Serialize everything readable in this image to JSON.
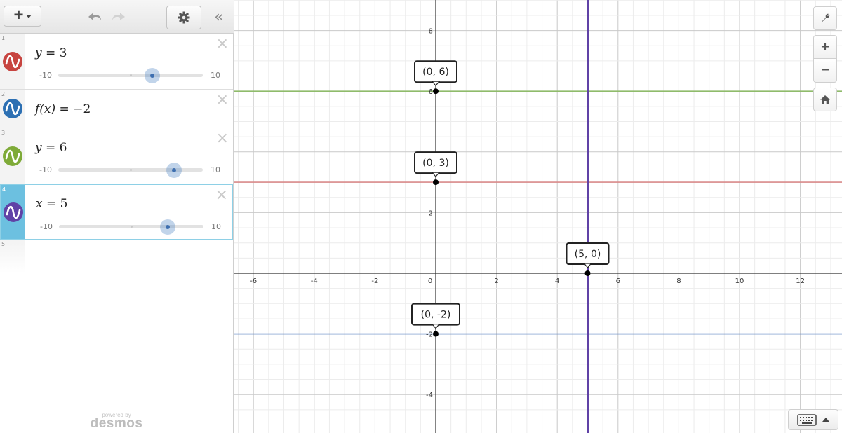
{
  "toolbar": {
    "add_label": "+",
    "collapse_label": "«"
  },
  "expressions": [
    {
      "index": "1",
      "latex_left": "y",
      "latex_right": "3",
      "color": "#c74440",
      "slider": {
        "min": "-10",
        "max": "10",
        "value": 3
      }
    },
    {
      "index": "2",
      "latex_left": "f(x)",
      "latex_right": "−2",
      "color": "#2d70b3",
      "slider": null
    },
    {
      "index": "3",
      "latex_left": "y",
      "latex_right": "6",
      "color": "#388c46",
      "slider": {
        "min": "-10",
        "max": "10",
        "value": 6
      }
    },
    {
      "index": "4",
      "latex_left": "x",
      "latex_right": "5",
      "color": "#6042a6",
      "slider": {
        "min": "-10",
        "max": "10",
        "value": 5
      }
    },
    {
      "index": "5"
    }
  ],
  "branding": {
    "powered_by": "powered by",
    "name": "desmos"
  },
  "graph": {
    "x_ticks": [
      "-6",
      "-4",
      "-2",
      "0",
      "2",
      "4",
      "6",
      "8",
      "10",
      "12"
    ],
    "y_ticks": [
      "8",
      "6",
      "2",
      "-2",
      "-4"
    ],
    "points": [
      {
        "label": "(0, 6)",
        "x": 0,
        "y": 6
      },
      {
        "label": "(0, 3)",
        "x": 0,
        "y": 3
      },
      {
        "label": "(5, 0)",
        "x": 5,
        "y": 0
      },
      {
        "label": "(0, -2)",
        "x": 0,
        "y": -2
      }
    ],
    "lines": [
      {
        "type": "horizontal",
        "value": 6,
        "color": "#8fbb6b"
      },
      {
        "type": "horizontal",
        "value": 3,
        "color": "#d98a8a"
      },
      {
        "type": "horizontal",
        "value": -2,
        "color": "#6c8fc9"
      },
      {
        "type": "vertical",
        "value": 5,
        "color": "#6042a6"
      }
    ]
  },
  "controls": {
    "zoom_in": "+",
    "zoom_out": "−"
  }
}
